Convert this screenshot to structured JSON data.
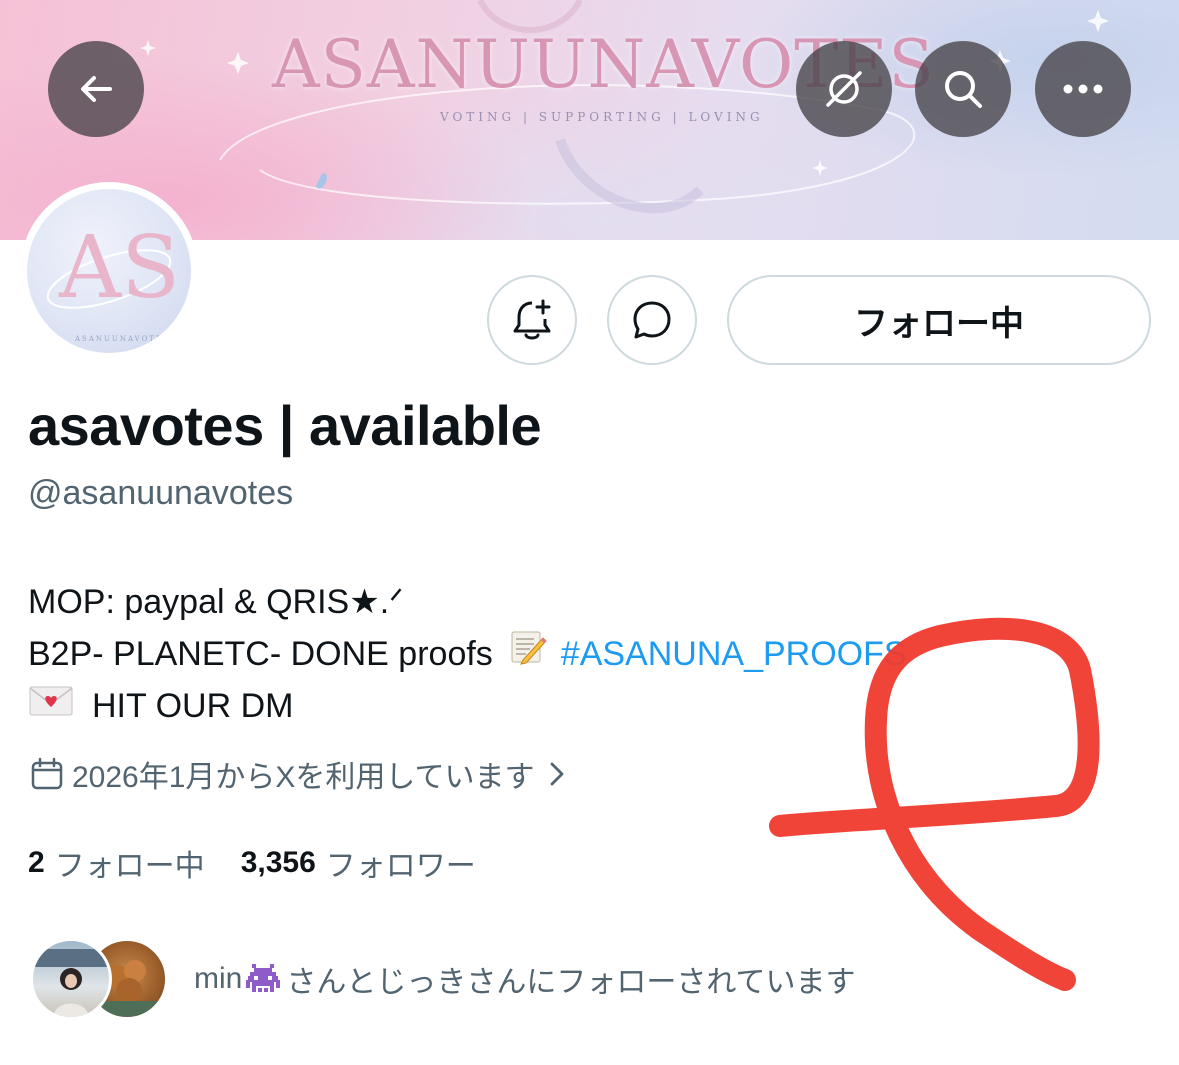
{
  "banner": {
    "title": "ASANUUNAVOTES",
    "subtitle": "VOTING | SUPPORTING | LOVING"
  },
  "header_icons": {
    "back": "arrow-left-icon",
    "grok": "grok-icon",
    "search": "search-icon",
    "more": "more-icon"
  },
  "avatar": {
    "monogram": "AS",
    "ring_text": "ASANUUNAVOTES"
  },
  "actions": {
    "notify_icon": "bell-plus-icon",
    "message_icon": "message-bubble-icon",
    "follow_label": "フォロー中"
  },
  "profile": {
    "display_name": "asavotes | available",
    "handle": "@asanuunavotes",
    "bio": {
      "line1": "MOP: paypal & QRIS★.ᐟ",
      "line2_text": "B2P- PLANETC- DONE proofs",
      "line2_emoji": "memo-emoji",
      "line2_hashtag": "#ASANUNA_PROOFS",
      "line3_emoji": "love-letter-emoji",
      "line3_text": "HIT OUR DM"
    },
    "joined": "2026年1月からXを利用しています",
    "following_count": "2",
    "following_label": "フォロー中",
    "followers_count": "3,356",
    "followers_label": "フォロワー",
    "followed_by_prefix": "min",
    "followed_by_emoji": "alien-monster-emoji",
    "followed_by_text": "さんとじっきさんにフォローされています"
  },
  "colors": {
    "link": "#1d9bf0",
    "secondary_text": "#536471",
    "border": "#cfd9de",
    "annotation": "#e8332a"
  }
}
